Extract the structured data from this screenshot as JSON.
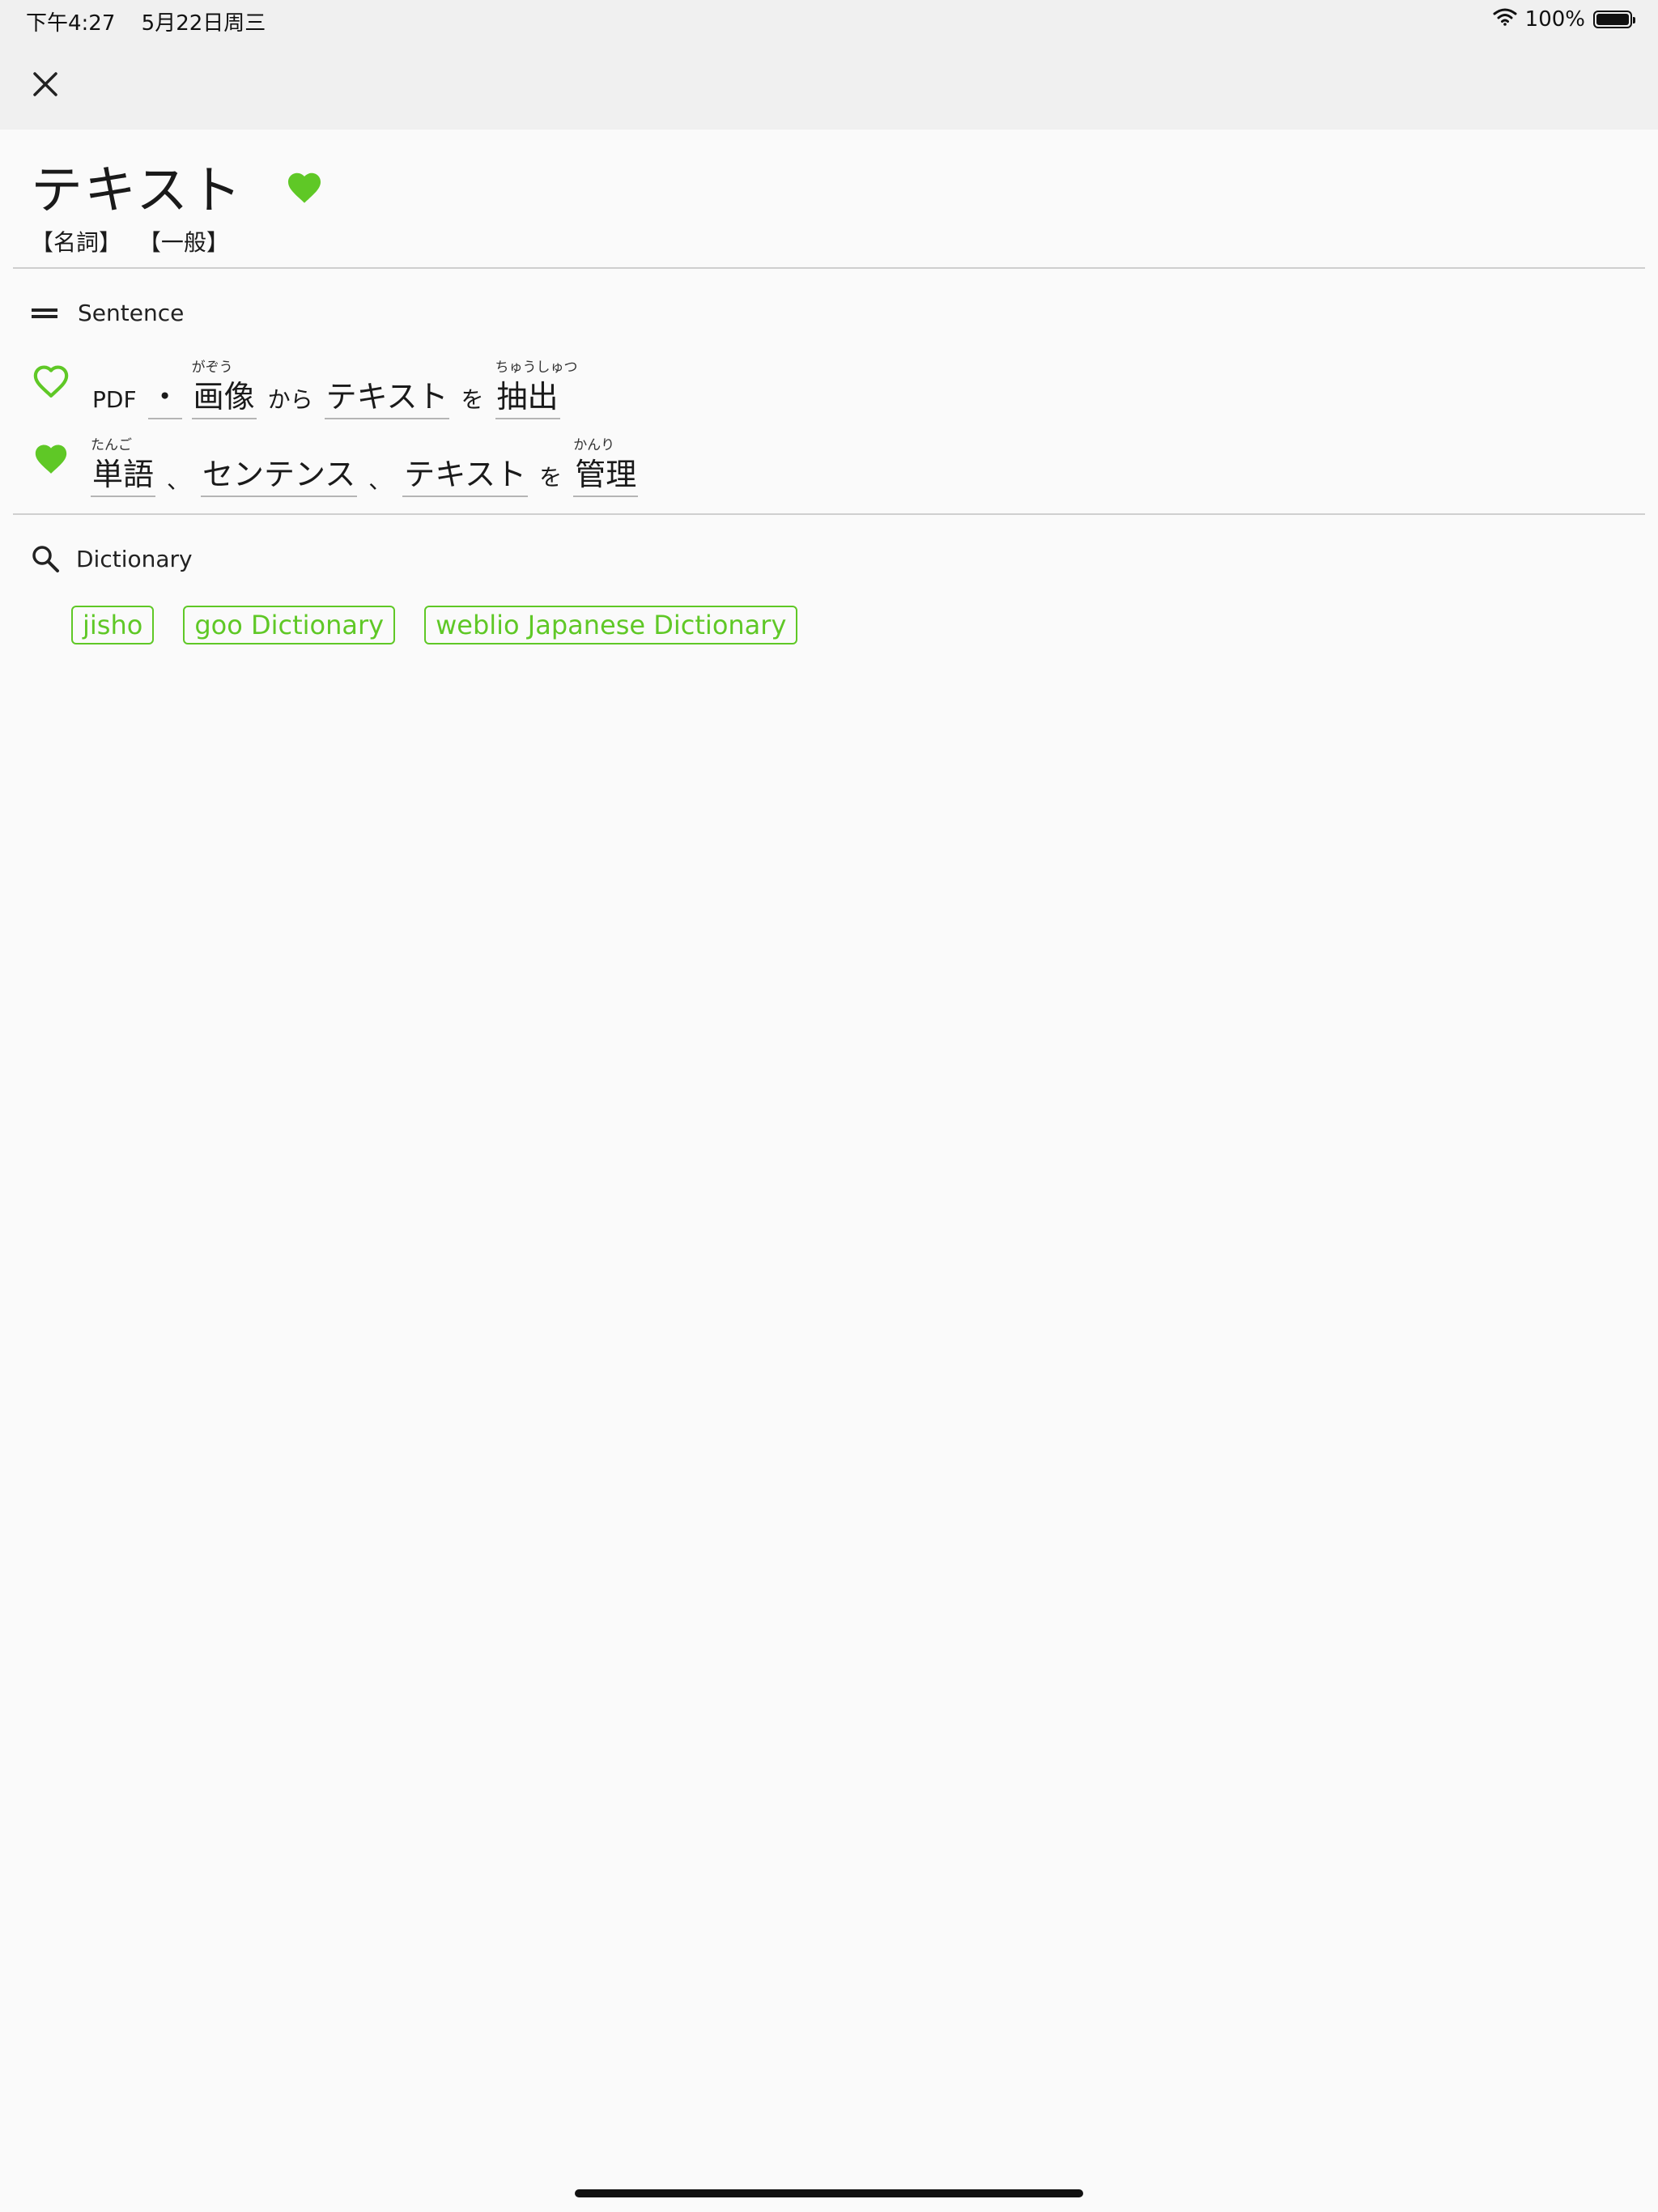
{
  "status_bar": {
    "time": "下午4:27",
    "date": "5月22日周三",
    "battery": "100%",
    "battery_level": 1.0
  },
  "entry": {
    "word": "テキスト",
    "favorited": true,
    "pos_tags": [
      "【名詞】",
      "【一般】"
    ]
  },
  "sentence_section": {
    "label": "Sentence",
    "sentences": [
      {
        "favorited": false,
        "tokens": [
          {
            "text": "PDF",
            "ruby": "",
            "style": "plain"
          },
          {
            "text": "・",
            "ruby": "",
            "style": "word"
          },
          {
            "text": "画像",
            "ruby": "がぞう",
            "style": "word"
          },
          {
            "text": "から",
            "ruby": "",
            "style": "plain"
          },
          {
            "text": "テキスト",
            "ruby": "",
            "style": "word"
          },
          {
            "text": "を",
            "ruby": "",
            "style": "plain"
          },
          {
            "text": "抽出",
            "ruby": "ちゅうしゅつ",
            "style": "word"
          }
        ]
      },
      {
        "favorited": true,
        "tokens": [
          {
            "text": "単語",
            "ruby": "たんご",
            "style": "word"
          },
          {
            "text": "、",
            "ruby": "",
            "style": "plain-punct"
          },
          {
            "text": "センテンス",
            "ruby": "",
            "style": "word"
          },
          {
            "text": "、",
            "ruby": "",
            "style": "plain-punct"
          },
          {
            "text": "テキスト",
            "ruby": "",
            "style": "word"
          },
          {
            "text": "を",
            "ruby": "",
            "style": "plain"
          },
          {
            "text": "管理",
            "ruby": "かんり",
            "style": "word"
          }
        ]
      }
    ]
  },
  "dictionary_section": {
    "label": "Dictionary",
    "links": [
      "jisho",
      "goo Dictionary",
      "weblio Japanese Dictionary"
    ]
  },
  "colors": {
    "accent": "#5fc826",
    "header_bg": "#f0f0f0",
    "page_bg": "#fafafa",
    "divider": "#cfcfcf"
  }
}
